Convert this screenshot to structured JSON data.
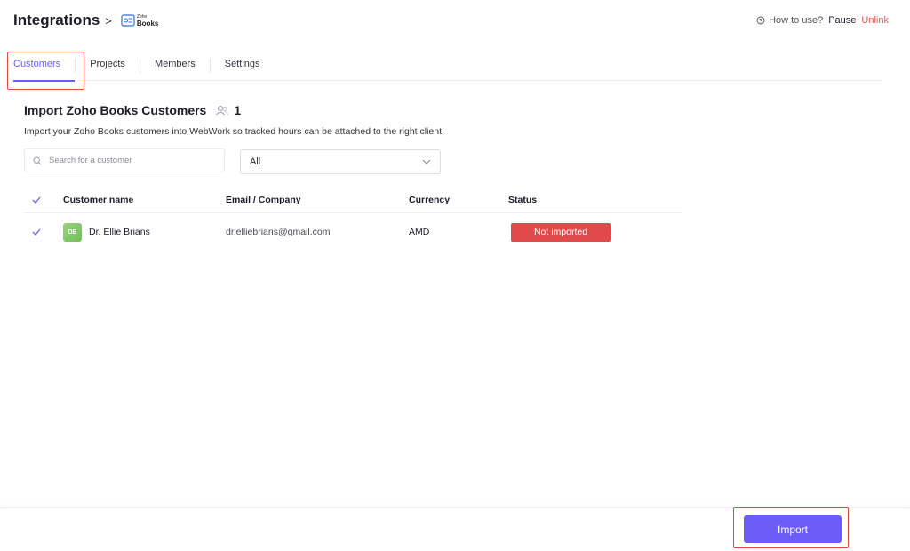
{
  "header": {
    "title": "Integrations",
    "separator": ">",
    "logo": {
      "small_text": "Zoho",
      "big_text": "Books",
      "icon": "zoho-books-icon"
    },
    "how_to_use": "How to use?",
    "pause": "Pause",
    "unlink": "Unlink",
    "unlink_color": "#e8544e"
  },
  "tabs": [
    {
      "label": "Customers",
      "active": true
    },
    {
      "label": "Projects",
      "active": false
    },
    {
      "label": "Members",
      "active": false
    },
    {
      "label": "Settings",
      "active": false
    }
  ],
  "section": {
    "title": "Import Zoho Books Customers",
    "count": "1",
    "description": "Import your Zoho Books customers into WebWork so tracked hours can be attached to the right client."
  },
  "filters": {
    "search_placeholder": "Search for a customer",
    "select_value": "All"
  },
  "table": {
    "columns": [
      "Customer name",
      "Email / Company",
      "Currency",
      "Status"
    ],
    "rows": [
      {
        "initials": "DE",
        "name": "Dr. Ellie Brians",
        "email": "dr.elliebrians@gmail.com",
        "currency": "AMD",
        "status": "Not imported",
        "checked": true
      }
    ]
  },
  "footer": {
    "import_label": "Import"
  },
  "colors": {
    "accent": "#6b5df5",
    "danger": "#e04a4a",
    "highlight": "#e04a3a"
  }
}
